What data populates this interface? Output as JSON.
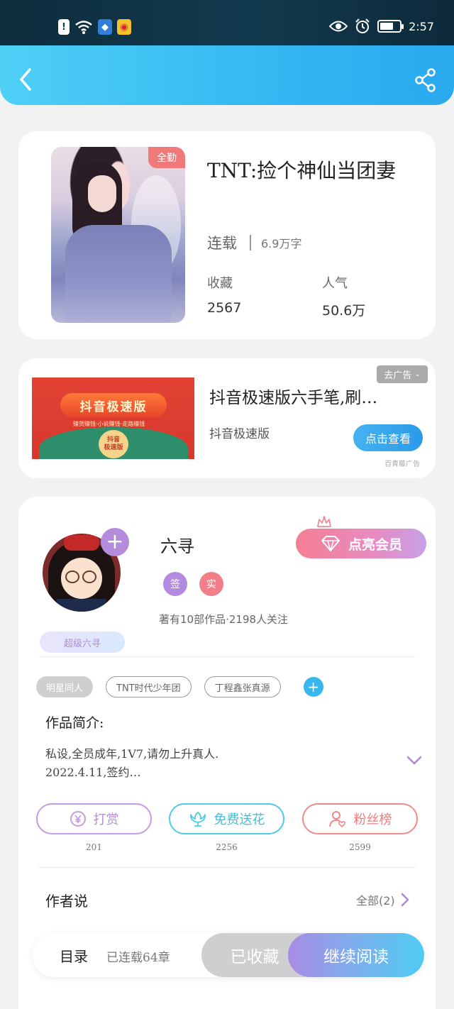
{
  "status_bar": {
    "time": "2:57",
    "icons": [
      "alert-icon",
      "wifi-icon",
      "shield-app-icon",
      "weibo-icon",
      "eye-icon",
      "alarm-icon",
      "battery-charging-icon"
    ]
  },
  "header": {
    "back_icon": "chevron-left-icon",
    "share_icon": "share-icon",
    "color": "#35b7f2"
  },
  "book": {
    "cover_badge": "全勤",
    "title": "TNT:捡个神仙当团妻",
    "status": "连载",
    "word_count": "6.9万字",
    "stats": [
      {
        "label": "收藏",
        "value": "2567"
      },
      {
        "label": "人气",
        "value": "50.6万"
      }
    ]
  },
  "ad": {
    "close_label": "去广告",
    "banner_title": "抖音极速版",
    "banner_sub": "赚货赚钱·小说赚钱·走路赚钱",
    "banner_medal": "抖音\n极速版",
    "title": "抖音极速版六手笔,刷…",
    "source": "抖音极速版",
    "button": "点击查看",
    "provider": "百青藤广告"
  },
  "author": {
    "name": "六寻",
    "badges": [
      {
        "label": "签",
        "color": "#b28be0"
      },
      {
        "label": "实",
        "color": "#f27e8a"
      }
    ],
    "stats": "著有10部作品·2198人关注",
    "fan_badge": "超级六寻",
    "vip_button": "点亮会员"
  },
  "tags": [
    "明星同人",
    "TNT时代少年团",
    "丁程鑫张真源"
  ],
  "intro": {
    "heading": "作品简介:",
    "text": "私设,全员成年,1V7,请勿上升真人.\n2022.4.11,签约…"
  },
  "actions": [
    {
      "label": "打赏",
      "icon": "yen-coin-icon",
      "count": "201",
      "color": "#c59be6"
    },
    {
      "label": "免费送花",
      "icon": "flower-icon",
      "count": "2256",
      "color": "#4ecbe5"
    },
    {
      "label": "粉丝榜",
      "icon": "fan-ranking-icon",
      "count": "2599",
      "color": "#ef8a8a"
    }
  ],
  "author_says": {
    "heading": "作者说",
    "all_label": "全部(2)"
  },
  "bottom_bar": {
    "catalog": "目录",
    "progress": "已连载64章",
    "collected": "已收藏",
    "continue": "继续阅读"
  }
}
